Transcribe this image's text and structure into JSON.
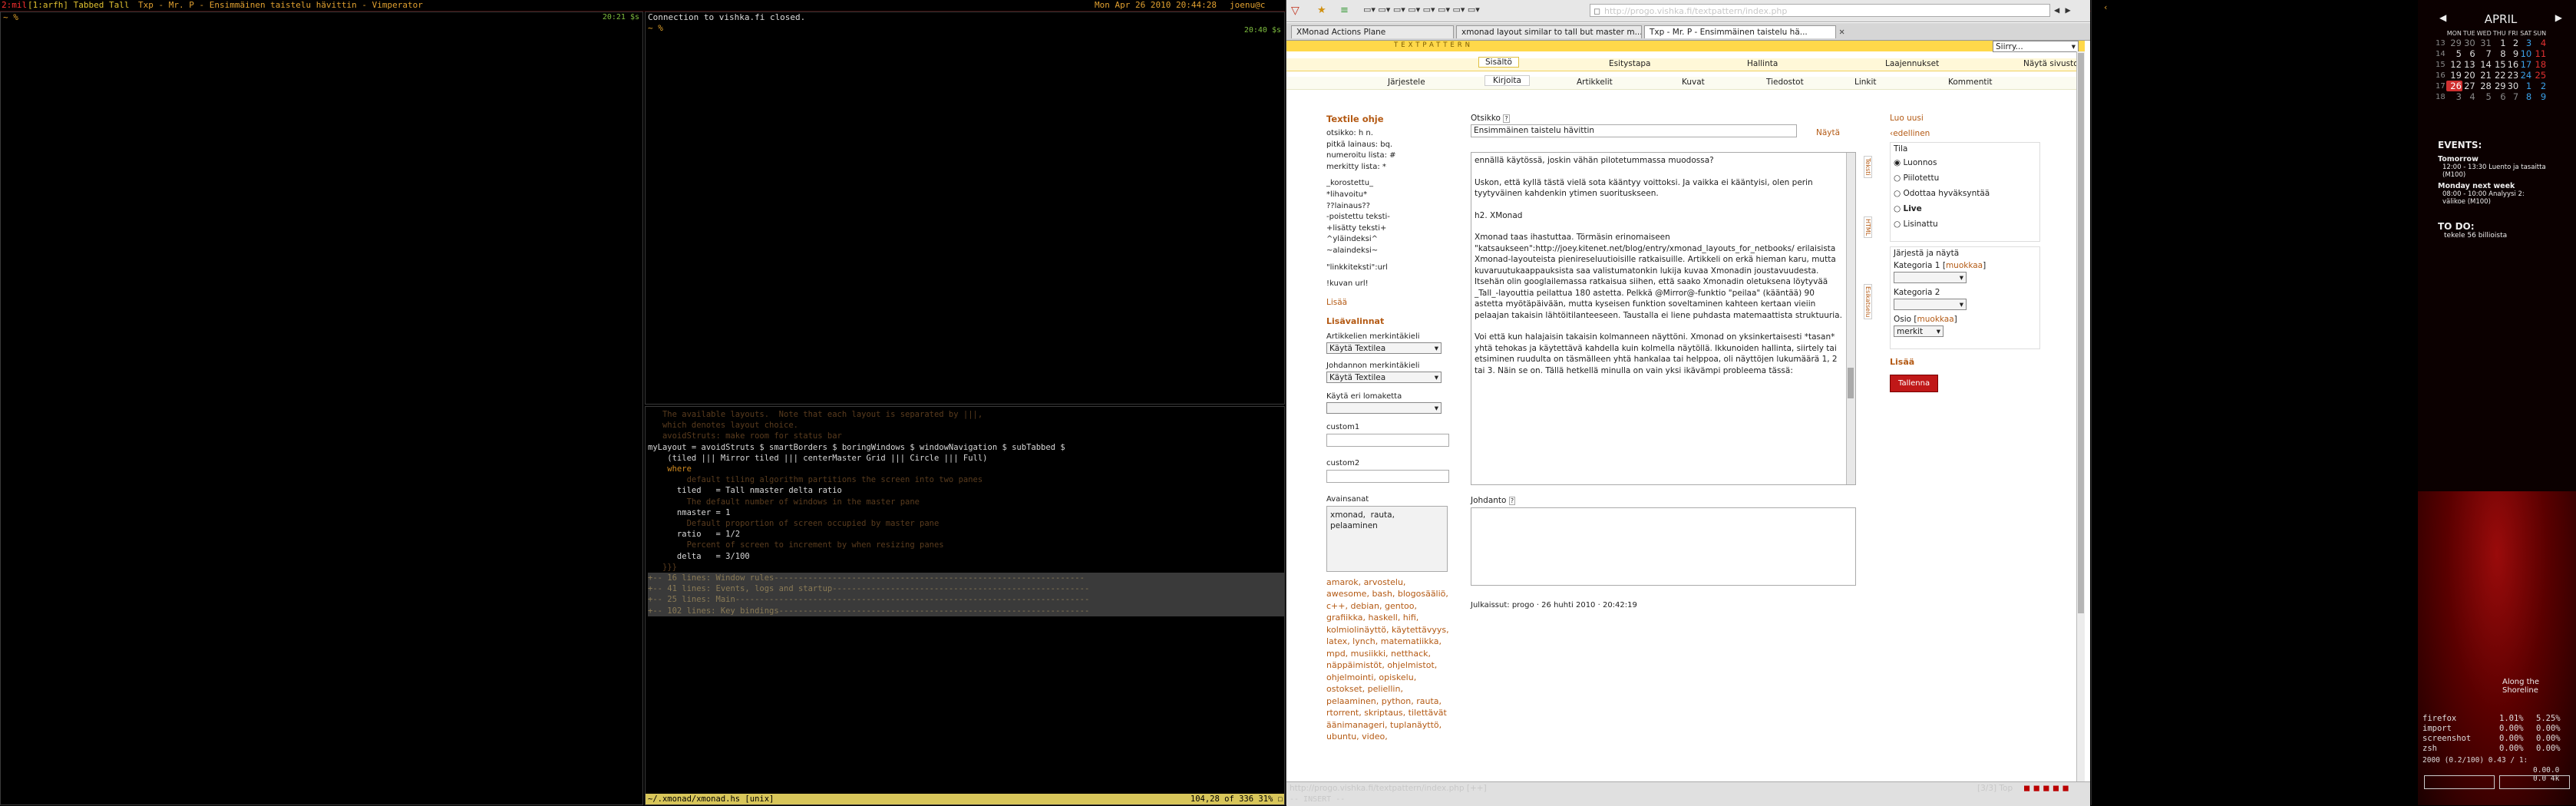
{
  "topbar": {
    "workspace": "2:mil",
    "layout": "[1:arfh]  Tabbed Tall",
    "title": "Txp - Mr. P - Ensimmäinen taistelu hävittin - Vimperator",
    "datetime": "Mon Apr 26 2010 20:44:28",
    "user": "joenu@c"
  },
  "term1": {
    "lines": [
      "~ %"
    ],
    "clock": "20:21 $s"
  },
  "term2": {
    "lines": [
      "Connection to vishka.fi closed.",
      "~ %"
    ],
    "clock": "20:40 $s"
  },
  "editor": {
    "lines": [
      {
        "t": "   The available layouts.  Note that each layout is separated by |||,",
        "c": "cm"
      },
      {
        "t": "   which denotes layout choice.",
        "c": "cm"
      },
      {
        "t": "",
        "c": ""
      },
      {
        "t": "   avoidStruts: make room for status bar",
        "c": "cm"
      },
      {
        "t": "",
        "c": ""
      },
      {
        "t": "myLayout = avoidStruts $ smartBorders $ boringWindows $ windowNavigation $ subTabbed $",
        "c": ""
      },
      {
        "t": "    (tiled ||| Mirror tiled ||| centerMaster Grid ||| Circle ||| Full)",
        "c": ""
      },
      {
        "t": "    where",
        "c": "kw"
      },
      {
        "t": "        default tiling algorithm partitions the screen into two panes",
        "c": "cm"
      },
      {
        "t": "      tiled   = Tall nmaster delta ratio",
        "c": ""
      },
      {
        "t": "        The default number of windows in the master pane",
        "c": "cm"
      },
      {
        "t": "      nmaster = 1",
        "c": ""
      },
      {
        "t": "        Default proportion of screen occupied by master pane",
        "c": "cm"
      },
      {
        "t": "      ratio   = 1/2",
        "c": ""
      },
      {
        "t": "        Percent of screen to increment by when resizing panes",
        "c": "cm"
      },
      {
        "t": "      delta   = 3/100",
        "c": ""
      },
      {
        "t": "",
        "c": ""
      },
      {
        "t": "",
        "c": ""
      },
      {
        "t": "",
        "c": ""
      },
      {
        "t": "   }}}",
        "c": "cm"
      },
      {
        "t": "+-- 16 lines: Window rules----------------------------------------------------------------",
        "c": "fold"
      },
      {
        "t": "+-- 41 lines: Events, logs and startup-----------------------------------------------------",
        "c": "fold"
      },
      {
        "t": "+-- 25 lines: Main-------------------------------------------------------------------------",
        "c": "fold"
      },
      {
        "t": "+-- 102 lines: Key bindings----------------------------------------------------------------",
        "c": "fold"
      }
    ],
    "status_file": "~/.xmonad/xmonad.hs [unix]",
    "status_pos": "104,28 of 336 31% ☐"
  },
  "browser": {
    "url": "http://progo.vishka.fi/textpattern/index.php",
    "search_placeholder": "",
    "tabs": [
      {
        "label": "XMonad Actions Plane",
        "active": false
      },
      {
        "label": "xmonad layout similar to tall but master m...",
        "active": false
      },
      {
        "label": "Txp - Mr. P - Ensimmäinen taistelu hä...",
        "active": true
      }
    ],
    "status_url": "http://progo.vishka.fi/textpattern/index.php [++]",
    "status_right": "[3/3]  Top",
    "mode": "-- INSERT --"
  },
  "txp": {
    "brand": "TEXTPATTERN",
    "siirry": "Siirry...",
    "main_tabs": [
      "Sisältö",
      "Esitystapa",
      "Hallinta",
      "Laajennukset",
      "Näytä sivusto"
    ],
    "sub_tabs": [
      "Järjestele",
      "Kirjoita",
      "Artikkelit",
      "Kuvat",
      "Tiedostot",
      "Linkit",
      "Kommentit"
    ],
    "help_title": "Textile ohje",
    "help_lines": [
      "otsikko: h n.",
      "pitkä lainaus: bq.",
      "numeroitu lista: #",
      "merkitty lista: *",
      "",
      "_korostettu_",
      "*lihavoitu*",
      "??lainaus??",
      "-poistettu teksti-",
      "+lisätty teksti+",
      "^yläindeksi^",
      "~alaindeksi~",
      "",
      "\"linkkiteksti\":url",
      "",
      "!kuvan url!"
    ],
    "more": "Lisää",
    "extra_title": "Lisävalinnat",
    "article_markup_label": "Artikkelien merkintäkieli",
    "article_markup_value": "Käytä Textilea",
    "excerpt_markup_label": "Johdannon merkintäkieli",
    "excerpt_markup_value": "Käytä Textilea",
    "override_label": "Käytä eri lomaketta",
    "custom1": "custom1",
    "custom2": "custom2",
    "keywords_label": "Avainsanat",
    "keywords_value": "xmonad,  rauta,\npelaaminen",
    "tags": "amarok, arvostelu, awesome, bash, blogosääliö, c++, debian, gentoo, grafiikka, haskell, hifi, kolmiolinäyttö, käytettävyys, latex, lynch, matematiikka, mpd, musiikki, netthack, näppäimistöt, ohjelmistot, ohjelmointi, opiskelu, ostokset, peliellin, pelaaminen, python, rauta, rtorrent, skriptaus, tilettävät äänimanageri, tuplanäyttö, ubuntu, video,",
    "title_label": "Otsikko",
    "title_value": "Ensimmäinen taistelu hävittin",
    "view": "Näytä",
    "body_text": [
      "ennällä käytössä, joskin vähän pilotetummassa muodossa?",
      "",
      "Uskon, että kyllä tästä vielä sota kääntyy voittoksi. Ja vaikka ei kääntyisi, olen perin tyytyväinen kahdenkin ytimen suorituskseen.",
      "",
      "h2. XMonad",
      "",
      "Xmonad taas ihastuttaa. Törmäsin erinomaiseen \"katsaukseen\":http://joey.kitenet.net/blog/entry/xmonad_layouts_for_netbooks/ erilaisista Xmonad-layouteista pienireseluutioisille ratkaisuille. Artikkeli on erkä hieman karu, mutta kuvaruutukaappauksista saa valistumatonkin lukija kuvaa Xmonadin joustavuudesta. Itsehän olin googlailemassa ratkaisua siihen, että saako Xmonadin oletuksena löytyvää _Tall_-layouttia peilattua 180 astetta. Pelkkä @Mirror@-funktio \"peilaa\" (kääntää) 90 astetta myötäpäivään, mutta kyseisen funktion soveltaminen kahteen kertaan vieiin pelaajan takaisin lähtöitilanteeseen. Taustalla ei liene puhdasta matemaattista struktuuria.",
      "",
      "Voi että kun halajaisin takaisin kolmanneen näyttöni. Xmonad on yksinkertaisesti *tasan* yhtä tehokas ja käytettävä kahdella kuin kolmella näytöllä. Ikkunoiden hallinta, siirtely tai etsiminen ruudulta on täsmälleen yhtä hankalaa tai helppoa, oli näyttöjen lukumäärä 1, 2 tai 3. Näin se on. Tällä hetkellä minulla on vain yksi ikävämpi probleema tässä:"
    ],
    "excerpt_label": "Johdanto",
    "published": "Julkaissut: progo · 26 huhti 2010 · 20:42:19",
    "new_link": "Luo uusi",
    "prev_link": "edellinen",
    "status_title": "Tila",
    "status_options": [
      "Luonnos",
      "Piilotettu",
      "Odottaa hyväksyntää",
      "Live",
      "Lisinattu"
    ],
    "status_selected": 0,
    "sort_title": "Järjestä ja näytä",
    "cat1_label": "Kategoria 1",
    "cat2_label": "Kategoria 2",
    "edit": "muokkaa",
    "section_label": "Osio",
    "section_value": "merkit",
    "more2": "Lisää",
    "save": "Tallenna",
    "side_tabs": [
      "Teksti",
      "HTML",
      "Esikatselu"
    ]
  },
  "sidebar": {
    "month": "APRIL",
    "weekdays": [
      "MON",
      "TUE",
      "WED",
      "THU",
      "FRI",
      "SAT",
      "SUN"
    ],
    "weeks": [
      {
        "wk": "13",
        "days": [
          "29",
          "30",
          "31",
          "1",
          "2",
          "3",
          "4"
        ]
      },
      {
        "wk": "14",
        "days": [
          "5",
          "6",
          "7",
          "8",
          "9",
          "10",
          "11"
        ]
      },
      {
        "wk": "15",
        "days": [
          "12",
          "13",
          "14",
          "15",
          "16",
          "17",
          "18"
        ]
      },
      {
        "wk": "16",
        "days": [
          "19",
          "20",
          "21",
          "22",
          "23",
          "24",
          "25"
        ]
      },
      {
        "wk": "17",
        "days": [
          "26",
          "27",
          "28",
          "29",
          "30",
          "1",
          "2"
        ]
      },
      {
        "wk": "18",
        "days": [
          "3",
          "4",
          "5",
          "6",
          "7",
          "8",
          "9"
        ]
      }
    ],
    "events_title": "EVENTS:",
    "events": [
      {
        "head": "Tomorrow",
        "lines": [
          "12:00 - 13:30 Luento ja tasaitta",
          "(M100)"
        ]
      },
      {
        "head": "Monday next week",
        "lines": [
          "08:00 - 10:00 Analyysi 2:",
          "välikoe (M100)"
        ]
      }
    ],
    "todo_title": "TO DO:",
    "todo": [
      "tekele 56 billioista"
    ],
    "song": "Along the Shoreline",
    "procs": [
      {
        "name": "firefox",
        "a": "1.01%",
        "b": "5.25%"
      },
      {
        "name": "import",
        "a": "0.00%",
        "b": "0.00%"
      },
      {
        "name": "screenshot",
        "a": "0.00%",
        "b": "0.00%"
      },
      {
        "name": "zsh",
        "a": "0.00%",
        "b": "0.00%"
      }
    ],
    "load": "2000 (0.2/100)  0.43 / 1:",
    "netline": "0.00.0 0.0 4k"
  }
}
